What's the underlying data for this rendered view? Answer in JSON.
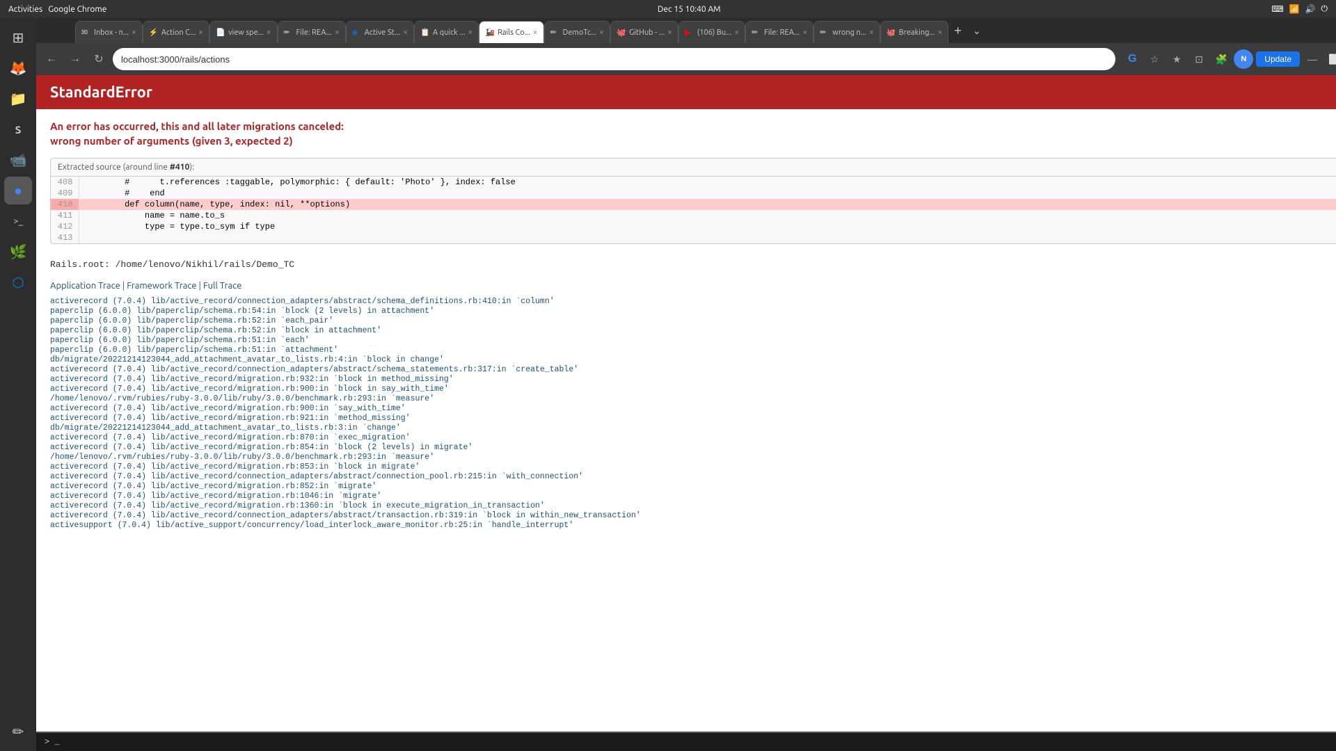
{
  "os": {
    "activities_label": "Activities",
    "app_name": "Google Chrome",
    "datetime": "Dec 15  10:40 AM"
  },
  "browser": {
    "tabs": [
      {
        "id": "inbox",
        "label": "Inbox - n...",
        "favicon": "✉",
        "active": false
      },
      {
        "id": "action",
        "label": "Action C...",
        "favicon": "⚡",
        "active": false
      },
      {
        "id": "view-spec",
        "label": "view spe...",
        "favicon": "📄",
        "active": false
      },
      {
        "id": "file-readme1",
        "label": "File: REA...",
        "favicon": "✏",
        "active": false
      },
      {
        "id": "active-s",
        "label": "Active St...",
        "favicon": "🔷",
        "active": false
      },
      {
        "id": "a-quick",
        "label": "A quick ...",
        "favicon": "📋",
        "active": false
      },
      {
        "id": "rails-co",
        "label": "Rails Co...",
        "favicon": "🚂",
        "active": true
      },
      {
        "id": "demotc",
        "label": "DemoTc...",
        "favicon": "✏",
        "active": false
      },
      {
        "id": "github",
        "label": "GitHub - ...",
        "favicon": "🐙",
        "active": false
      },
      {
        "id": "106-bu",
        "label": "(106) Bu...",
        "favicon": "▶",
        "active": false
      },
      {
        "id": "file-readme2",
        "label": "File: REA...",
        "favicon": "✏",
        "active": false
      },
      {
        "id": "wrong-n",
        "label": "wrong n...",
        "favicon": "✏",
        "active": false
      },
      {
        "id": "breaking",
        "label": "Breaking...",
        "favicon": "🐙",
        "active": false
      }
    ],
    "address": "localhost:3000/rails/actions",
    "update_button": "Update"
  },
  "page": {
    "error_type": "StandardError",
    "error_intro": "An error has occurred, this and all later migrations canceled:",
    "error_detail": "wrong number of arguments (given 3, expected 2)",
    "source_label": "Extracted source (around line ",
    "source_line_num": "#410",
    "source_label_end": "):",
    "source_lines": [
      {
        "num": "408",
        "code": "        #      t.references :taggable, polymorphic: { default: 'Photo' }, index: false",
        "highlight": false
      },
      {
        "num": "409",
        "code": "        #    end",
        "highlight": false
      },
      {
        "num": "410",
        "code": "        def column(name, type, index: nil, **options)",
        "highlight": true
      },
      {
        "num": "411",
        "code": "            name = name.to_s",
        "highlight": false
      },
      {
        "num": "412",
        "code": "            type = type.to_sym if type",
        "highlight": false
      },
      {
        "num": "413",
        "code": "",
        "highlight": false
      }
    ],
    "rails_root": "Rails.root: /home/lenovo/Nikhil/rails/Demo_TC",
    "trace_links": [
      {
        "label": "Application Trace",
        "href": "#"
      },
      {
        "label": "Framework Trace",
        "href": "#"
      },
      {
        "label": "Full Trace",
        "href": "#"
      }
    ],
    "trace_items": [
      "activerecord (7.0.4) lib/active_record/connection_adapters/abstract/schema_definitions.rb:410:in `column'",
      "paperclip (6.0.0) lib/paperclip/schema.rb:54:in `block (2 levels) in attachment'",
      "paperclip (6.0.0) lib/paperclip/schema.rb:52:in `each_pair'",
      "paperclip (6.0.0) lib/paperclip/schema.rb:52:in `block in attachment'",
      "paperclip (6.0.0) lib/paperclip/schema.rb:51:in `each'",
      "paperclip (6.0.0) lib/paperclip/schema.rb:51:in `attachment'",
      "db/migrate/20221214123044_add_attachment_avatar_to_lists.rb:4:in `block in change'",
      "activerecord (7.0.4) lib/active_record/connection_adapters/abstract/schema_statements.rb:317:in `create_table'",
      "activerecord (7.0.4) lib/active_record/migration.rb:932:in `block in method_missing'",
      "activerecord (7.0.4) lib/active_record/migration.rb:900:in `block in say_with_time'",
      "/home/lenovo/.rvm/rubies/ruby-3.0.0/lib/ruby/3.0.0/benchmark.rb:293:in `measure'",
      "activerecord (7.0.4) lib/active_record/migration.rb:900:in `say_with_time'",
      "activerecord (7.0.4) lib/active_record/migration.rb:921:in `method_missing'",
      "db/migrate/20221214123044_add_attachment_avatar_to_lists.rb:3:in `change'",
      "activerecord (7.0.4) lib/active_record/migration.rb:870:in `exec_migration'",
      "activerecord (7.0.4) lib/active_record/migration.rb:854:in `block (2 levels) in migrate'",
      "/home/lenovo/.rvm/rubies/ruby-3.0.0/lib/ruby/3.0.0/benchmark.rb:293:in `measure'",
      "activerecord (7.0.4) lib/active_record/migration.rb:853:in `block in migrate'",
      "activerecord (7.0.4) lib/active_record/connection_adapters/abstract/connection_pool.rb:215:in `with_connection'",
      "activerecord (7.0.4) lib/active_record/migration.rb:852:in `migrate'",
      "activerecord (7.0.4) lib/active_record/migration.rb:1046:in `migrate'",
      "activerecord (7.0.4) lib/active_record/migration.rb:1360:in `block in execute_migration_in_transaction'",
      "activerecord (7.0.4) lib/active_record/connection_adapters/abstract/transaction.rb:319:in `block in within_new_transaction'",
      "activesupport (7.0.4) lib/active_support/concurrency/load_interlock_aware_monitor.rb:25:in `handle_interrupt'"
    ]
  },
  "terminal": {
    "prompt": "> _"
  },
  "sidebar": {
    "icons": [
      {
        "name": "apps-icon",
        "glyph": "⊞"
      },
      {
        "name": "firefox-icon",
        "glyph": "🦊"
      },
      {
        "name": "files-icon",
        "glyph": "📁"
      },
      {
        "name": "slack-icon",
        "glyph": "S"
      },
      {
        "name": "meet-icon",
        "glyph": "📹"
      },
      {
        "name": "chrome-icon",
        "glyph": "●"
      },
      {
        "name": "terminal-icon",
        "glyph": ">_"
      },
      {
        "name": "sourcetree-icon",
        "glyph": "🌳"
      },
      {
        "name": "vscode-icon",
        "glyph": "⬡"
      },
      {
        "name": "sublime-icon",
        "glyph": "✏"
      }
    ]
  }
}
